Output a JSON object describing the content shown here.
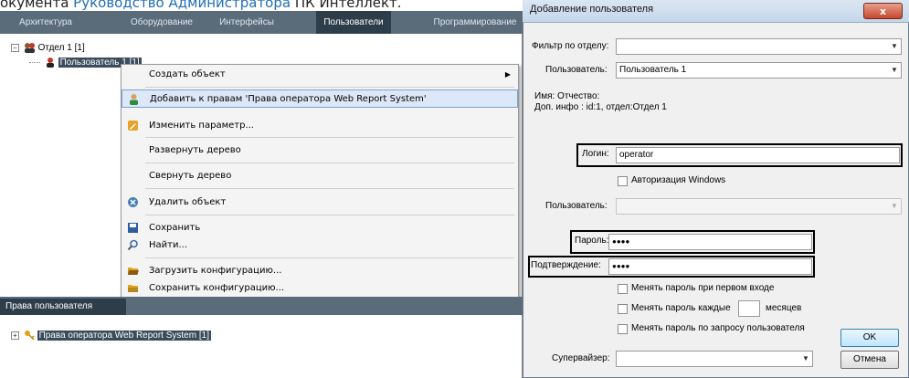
{
  "doc_caption": {
    "prefix": "окумента ",
    "link": "Руководство Администратора",
    "suffix": " ПК Интеллект."
  },
  "tabs": [
    "Архитектура",
    "Оборудование",
    "Интерфейсы",
    "Пользователи",
    "Программирование"
  ],
  "active_tab": "Пользователи",
  "tree": {
    "department": "Отдел 1 [1]",
    "user": "Пользователь 1 [1]"
  },
  "context_menu": {
    "items": [
      {
        "label": "Создать объект",
        "icon": "none",
        "submenu": true
      },
      {
        "label": "Добавить к правам 'Права оператора Web Report System'",
        "icon": "user-add-icon",
        "highlighted": true
      },
      {
        "label": "Изменить параметр...",
        "icon": "edit-icon"
      },
      {
        "label": "Развернуть дерево",
        "icon": "none"
      },
      {
        "label": "Свернуть дерево",
        "icon": "none"
      },
      {
        "label": "Удалить объект",
        "icon": "delete-icon"
      },
      {
        "label": "Сохранить",
        "icon": "save-icon"
      },
      {
        "label": "Найти...",
        "icon": "search-icon"
      },
      {
        "label": "Загрузить конфигурацию...",
        "icon": "folder-open-icon"
      },
      {
        "label": "Сохранить конфигурацию...",
        "icon": "folder-save-icon"
      }
    ]
  },
  "rights_panel": {
    "tab_label": "Права пользователя",
    "item": "Права оператора Web Report System [1]"
  },
  "dialog": {
    "title": "Добавление пользователя",
    "close": "x",
    "filter_label": "Фильтр по отделу:",
    "filter_value": "",
    "user_label": "Пользователь:",
    "user_value": "Пользователь 1",
    "info_name": "Имя: Отчество:",
    "info_extra": "Доп. инфо : id:1, отдел:Отдел 1",
    "login_label": "Логин:",
    "login_value": "operator",
    "windows_auth_label": "Авторизация Windows",
    "user2_label": "Пользователь:",
    "user2_value": "",
    "password_label": "Пароль:",
    "password_value": "●●●●",
    "confirm_label": "Подтверждение:",
    "confirm_value": "●●●●",
    "change_first_label": "Менять пароль при первом входе",
    "change_every_label": "Менять пароль каждые",
    "months_label": "месяцев",
    "months_value": "",
    "change_request_label": "Менять пароль по запросу пользователя",
    "supervisor_label": "Супервайзер:",
    "supervisor_value": "",
    "ok_label": "OK",
    "cancel_label": "Отмена"
  },
  "colors": {
    "tabbar": "#5a6b7a",
    "active_tab": "#2e3d4a",
    "link": "#1f6fb4",
    "menu_highlight": "#dce8f8"
  }
}
